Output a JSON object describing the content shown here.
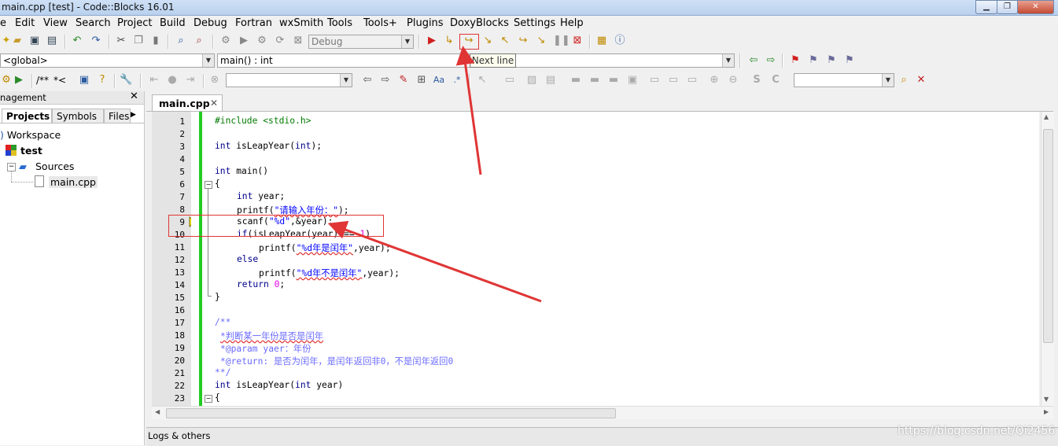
{
  "window": {
    "title": "main.cpp [test] - Code::Blocks 16.01",
    "min": "▁",
    "max": "❐",
    "close": "✕"
  },
  "menu": [
    "e",
    "Edit",
    "View",
    "Search",
    "Project",
    "Build",
    "Debug",
    "Fortran",
    "wxSmith",
    "Tools",
    "Tools+",
    "Plugins",
    "DoxyBlocks",
    "Settings",
    "Help"
  ],
  "toolbar": {
    "build_target": "Debug",
    "scope": "<global>",
    "function": "main() : int",
    "doxy_comment": "/**",
    "doxy_inline": "*<",
    "tooltip": "Next line",
    "search_text": "",
    "regex_text": ""
  },
  "management": {
    "header": "nagement",
    "tabs": [
      "Projects",
      "Symbols",
      "Files"
    ],
    "tree": {
      "workspace": "Workspace",
      "project": "test",
      "folder": "Sources",
      "file": "main.cpp"
    }
  },
  "editor": {
    "tab": "main.cpp",
    "lines": [
      "1",
      "2",
      "3",
      "4",
      "5",
      "6",
      "7",
      "8",
      "9",
      "10",
      "11",
      "12",
      "13",
      "14",
      "15",
      "16",
      "17",
      "18",
      "19",
      "20",
      "21",
      "22",
      "23"
    ],
    "code": {
      "l1": "#include <stdio.h>",
      "l3a": "int",
      "l3b": " isLeapYear(",
      "l3c": "int",
      "l3d": ");",
      "l5a": "int",
      "l5b": " main()",
      "l6": "{",
      "l7a": "int",
      "l7b": " year;",
      "l8a": "printf(",
      "l8b": "\"请输入年份：\"",
      "l8c": ");",
      "l9a": "scanf(",
      "l9b": "\"%d\"",
      "l9c": ",&year);",
      "l10a": "if",
      "l10b": "(isLeapYear(year) == ",
      "l10c": "1",
      "l10d": ")",
      "l11a": "printf(",
      "l11b": "\"%d年是闰年\"",
      "l11c": ",year);",
      "l12": "else",
      "l13a": "printf(",
      "l13b": "\"%d年不是闰年\"",
      "l13c": ",year);",
      "l14a": "return",
      "l14b": " 0",
      "l14c": ";",
      "l15": "}",
      "l17": "/**",
      "l18": "*判断某一年份是否是闰年",
      "l19": "*@param yaer：年份",
      "l20": "*@return: 是否为闰年，是闰年返回非0，不是闰年返回0",
      "l21": "**/",
      "l22a": "int",
      "l22b": " isLeapYear(",
      "l22c": "int",
      "l22d": " year)",
      "l23": "{"
    }
  },
  "bottom": {
    "logs": "Logs & others",
    "watermark": "https://blog.csdn.net/Qi2456"
  },
  "colors": {
    "breakpoint_arrow": "#f5e400",
    "annotation": "#e03535",
    "change_bar": "#22cc22"
  }
}
